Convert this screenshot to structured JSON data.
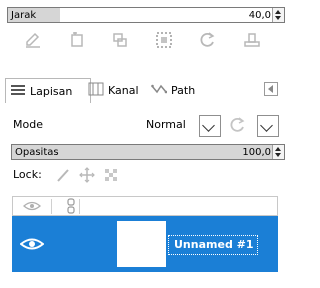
{
  "distance": {
    "label": "Jarak",
    "value": "40,0",
    "fill_fraction": 0.2
  },
  "toolbar": {
    "icons": [
      "pencil-icon",
      "copy-page-icon",
      "duplicate-icon",
      "dotted-frame-icon",
      "refresh-icon",
      "stamp-icon"
    ]
  },
  "tabs": [
    {
      "label": "Lapisan",
      "icon": "layers-icon",
      "active": true
    },
    {
      "label": "Kanal",
      "icon": "channels-icon",
      "active": false
    },
    {
      "label": "Path",
      "icon": "path-icon",
      "active": false
    }
  ],
  "mode": {
    "label": "Mode",
    "value": "Normal"
  },
  "opacity": {
    "label": "Opasitas",
    "value": "100,0",
    "fill_fraction": 1.0
  },
  "lock": {
    "label": "Lock:",
    "icons": [
      "paint-brush-icon",
      "move-cross-icon",
      "checkerboard-icon"
    ]
  },
  "layers": {
    "header_icons": [
      "eye-icon",
      "chain-link-icon"
    ],
    "items": [
      {
        "name": "Unnamed #1",
        "visible": true,
        "selected": true
      }
    ]
  },
  "colors": {
    "selection": "#1b7fd6",
    "spin_fill": "#d6d6d6"
  }
}
